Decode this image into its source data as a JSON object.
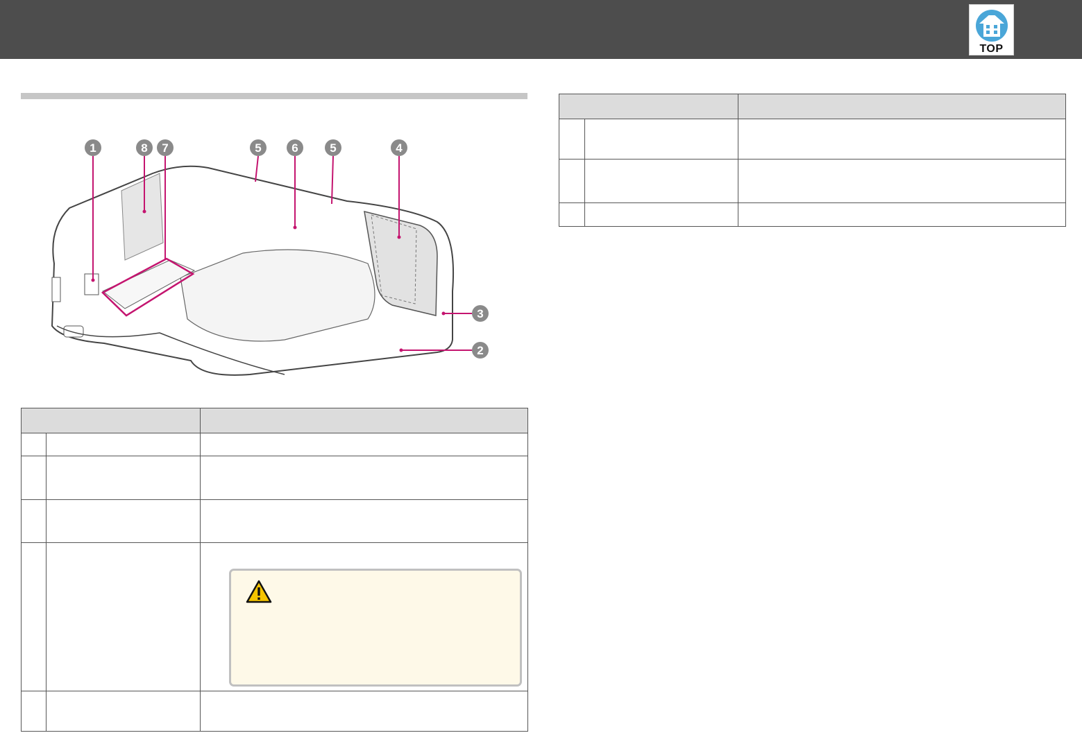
{
  "header": {
    "top_button_label": "TOP",
    "top_icon": "home-up-icon"
  },
  "figure": {
    "callouts": [
      "1",
      "8",
      "7",
      "5",
      "6",
      "5",
      "4",
      "3",
      "2"
    ]
  },
  "left_table": {
    "columns": [
      "",
      ""
    ],
    "rows": [
      {
        "num": ""
      },
      {
        "num": ""
      },
      {
        "num": ""
      },
      {
        "num": "",
        "warning_icon": "warning-triangle-icon"
      },
      {
        "num": ""
      }
    ]
  },
  "right_table": {
    "columns": [
      "",
      ""
    ],
    "rows": [
      {
        "num": ""
      },
      {
        "num": ""
      },
      {
        "num": ""
      }
    ]
  },
  "colors": {
    "header_bg": "#4d4d4d",
    "accent_blue": "#4aa6d8",
    "callout_pink": "#c4146f",
    "callout_gray": "#8a8a8a",
    "warning_bg": "#fef9e8"
  }
}
